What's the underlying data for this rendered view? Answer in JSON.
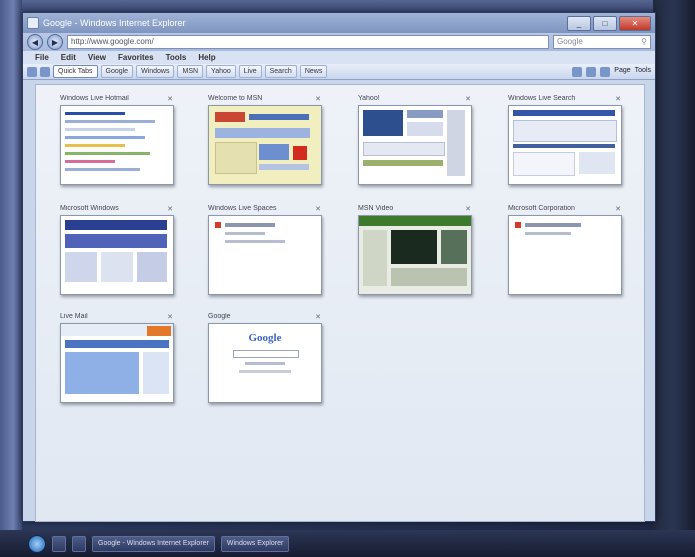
{
  "window": {
    "title": "Google - Windows Internet Explorer",
    "min_label": "_",
    "max_label": "□",
    "close_label": "✕"
  },
  "address": {
    "back": "◀",
    "forward": "▶",
    "url": "http://www.google.com/",
    "search_placeholder": "Google"
  },
  "menu": {
    "items": [
      "File",
      "Edit",
      "View",
      "Favorites",
      "Tools",
      "Help"
    ]
  },
  "toolbar": {
    "tabs": [
      "Quick Tabs",
      "Google",
      "Windows",
      "MSN",
      "Yahoo",
      "Live",
      "Search",
      "News"
    ],
    "right_items": [
      "Page",
      "Tools"
    ]
  },
  "tiles": [
    {
      "title": "Windows Live Hotmail"
    },
    {
      "title": "Welcome to MSN"
    },
    {
      "title": "Yahoo!"
    },
    {
      "title": "Windows Live Search"
    },
    {
      "title": "Microsoft Windows"
    },
    {
      "title": "Windows Live Spaces"
    },
    {
      "title": "MSN Video"
    },
    {
      "title": "Microsoft Corporation"
    },
    {
      "title": "Live Mail"
    },
    {
      "title": "Google"
    }
  ],
  "google_logo": "Google",
  "taskbar": {
    "items": [
      "Google - Windows Internet Explorer",
      "Windows Explorer"
    ]
  },
  "colors": {
    "accent": "#7f95c0",
    "google_blue": "#3b64c7",
    "google_red": "#d23a2a"
  }
}
